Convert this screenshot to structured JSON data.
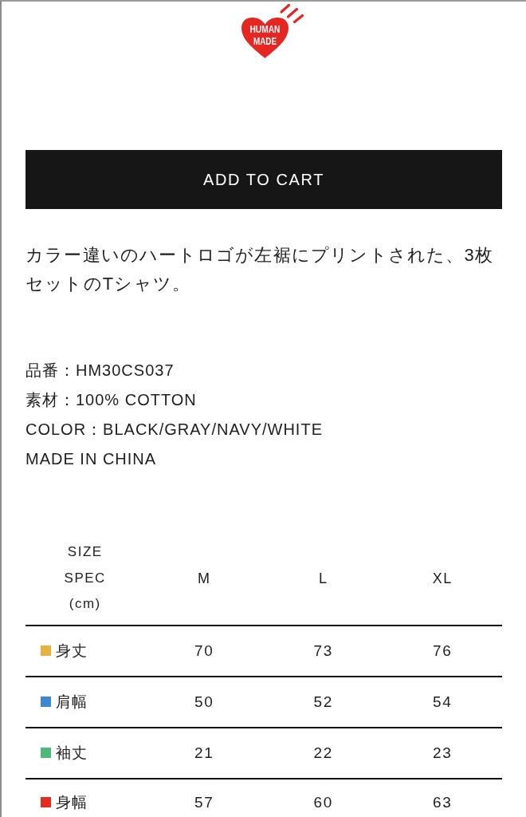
{
  "logo": {
    "lines": [
      "HUMAN",
      "MADE"
    ]
  },
  "add_to_cart_button": {
    "label": "ADD TO CART"
  },
  "description": "カラー違いのハートロゴが左裾にプリントされた、3枚セットのTシャツ。",
  "specs": [
    "品番：HM30CS037",
    "素材：100% COTTON",
    "COLOR：BLACK/GRAY/NAVY/WHITE",
    "MADE IN CHINA"
  ],
  "size_table": {
    "header_label": "SIZE SPEC (cm)",
    "columns": [
      "M",
      "L",
      "XL"
    ],
    "rows": [
      {
        "label": "身丈",
        "color": "#e8b23f",
        "values": [
          "70",
          "73",
          "76"
        ]
      },
      {
        "label": "肩幅",
        "color": "#3c87d2",
        "values": [
          "50",
          "52",
          "54"
        ]
      },
      {
        "label": "袖丈",
        "color": "#4dba7c",
        "values": [
          "21",
          "22",
          "23"
        ]
      },
      {
        "label": "身幅",
        "color": "#e32b1f",
        "values": [
          "57",
          "60",
          "63"
        ]
      }
    ]
  }
}
